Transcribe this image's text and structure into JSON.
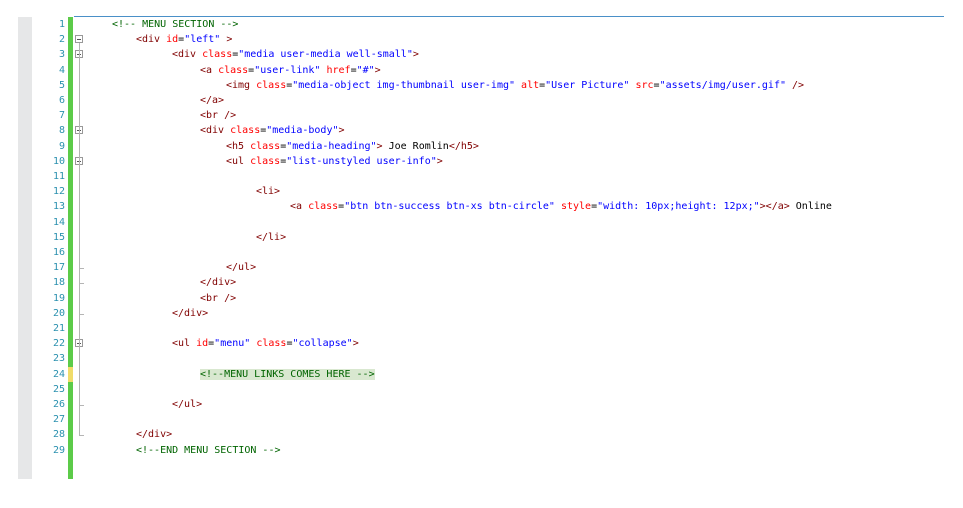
{
  "editor": {
    "line_numbers": [
      "1",
      "2",
      "3",
      "4",
      "5",
      "6",
      "7",
      "8",
      "9",
      "10",
      "11",
      "12",
      "13",
      "14",
      "15",
      "16",
      "17",
      "18",
      "19",
      "20",
      "21",
      "22",
      "23",
      "24",
      "25",
      "26",
      "27",
      "28",
      "29"
    ],
    "highlighted_line": 24,
    "colors": {
      "tag": "#800000",
      "attribute": "#ff0000",
      "value": "#0000ff",
      "comment": "#006400",
      "line_number": "#2b91af",
      "change_bar": "#5ccb49",
      "change_bar_modified": "#f0dc6a",
      "comment_highlight": "#d9e8d0"
    },
    "lines": [
      {
        "indent": 1,
        "tokens": [
          {
            "t": "comment",
            "v": "<!-- MENU SECTION -->"
          }
        ]
      },
      {
        "indent": 2,
        "tokens": [
          {
            "t": "tag",
            "v": "<div "
          },
          {
            "t": "attr",
            "v": "id"
          },
          {
            "t": "text",
            "v": "="
          },
          {
            "t": "val",
            "v": "\"left\""
          },
          {
            "t": "tag",
            "v": " >"
          }
        ]
      },
      {
        "indent": 3,
        "tokens": [
          {
            "t": "tag",
            "v": "<div "
          },
          {
            "t": "attr",
            "v": "class"
          },
          {
            "t": "text",
            "v": "="
          },
          {
            "t": "val",
            "v": "\"media user-media well-small\""
          },
          {
            "t": "tag",
            "v": ">"
          }
        ]
      },
      {
        "indent": 4,
        "tokens": [
          {
            "t": "tag",
            "v": "<a "
          },
          {
            "t": "attr",
            "v": "class"
          },
          {
            "t": "text",
            "v": "="
          },
          {
            "t": "val",
            "v": "\"user-link\""
          },
          {
            "t": "text",
            "v": " "
          },
          {
            "t": "attr",
            "v": "href"
          },
          {
            "t": "text",
            "v": "="
          },
          {
            "t": "val",
            "v": "\"#\""
          },
          {
            "t": "tag",
            "v": ">"
          }
        ]
      },
      {
        "indent": 5,
        "tokens": [
          {
            "t": "tag",
            "v": "<img "
          },
          {
            "t": "attr",
            "v": "class"
          },
          {
            "t": "text",
            "v": "="
          },
          {
            "t": "val",
            "v": "\"media-object img-thumbnail user-img\""
          },
          {
            "t": "text",
            "v": " "
          },
          {
            "t": "attr",
            "v": "alt"
          },
          {
            "t": "text",
            "v": "="
          },
          {
            "t": "val",
            "v": "\"User Picture\""
          },
          {
            "t": "text",
            "v": " "
          },
          {
            "t": "attr",
            "v": "src"
          },
          {
            "t": "text",
            "v": "="
          },
          {
            "t": "val",
            "v": "\"assets/img/user.gif\""
          },
          {
            "t": "tag",
            "v": " />"
          }
        ]
      },
      {
        "indent": 4,
        "tokens": [
          {
            "t": "tag",
            "v": "</a>"
          }
        ]
      },
      {
        "indent": 4,
        "tokens": [
          {
            "t": "tag",
            "v": "<br />"
          }
        ]
      },
      {
        "indent": 4,
        "tokens": [
          {
            "t": "tag",
            "v": "<div "
          },
          {
            "t": "attr",
            "v": "class"
          },
          {
            "t": "text",
            "v": "="
          },
          {
            "t": "val",
            "v": "\"media-body\""
          },
          {
            "t": "tag",
            "v": ">"
          }
        ]
      },
      {
        "indent": 5,
        "tokens": [
          {
            "t": "tag",
            "v": "<h5 "
          },
          {
            "t": "attr",
            "v": "class"
          },
          {
            "t": "text",
            "v": "="
          },
          {
            "t": "val",
            "v": "\"media-heading\""
          },
          {
            "t": "tag",
            "v": ">"
          },
          {
            "t": "text",
            "v": " Joe Romlin"
          },
          {
            "t": "tag",
            "v": "</h5>"
          }
        ]
      },
      {
        "indent": 5,
        "tokens": [
          {
            "t": "tag",
            "v": "<ul "
          },
          {
            "t": "attr",
            "v": "class"
          },
          {
            "t": "text",
            "v": "="
          },
          {
            "t": "val",
            "v": "\"list-unstyled user-info\""
          },
          {
            "t": "tag",
            "v": ">"
          }
        ]
      },
      {
        "indent": 0,
        "tokens": []
      },
      {
        "indent": 6,
        "tokens": [
          {
            "t": "tag",
            "v": "<li>"
          }
        ]
      },
      {
        "indent": 7,
        "tokens": [
          {
            "t": "tag",
            "v": "<a "
          },
          {
            "t": "attr",
            "v": "class"
          },
          {
            "t": "text",
            "v": "="
          },
          {
            "t": "val",
            "v": "\"btn btn-success btn-xs btn-circle\""
          },
          {
            "t": "text",
            "v": " "
          },
          {
            "t": "attr",
            "v": "style"
          },
          {
            "t": "text",
            "v": "="
          },
          {
            "t": "val",
            "v": "\"width: 10px;height: 12px;\""
          },
          {
            "t": "tag",
            "v": "></a>"
          },
          {
            "t": "text",
            "v": " Online"
          }
        ]
      },
      {
        "indent": 0,
        "tokens": []
      },
      {
        "indent": 6,
        "tokens": [
          {
            "t": "tag",
            "v": "</li>"
          }
        ]
      },
      {
        "indent": 0,
        "tokens": []
      },
      {
        "indent": 5,
        "tokens": [
          {
            "t": "tag",
            "v": "</ul>"
          }
        ]
      },
      {
        "indent": 4,
        "tokens": [
          {
            "t": "tag",
            "v": "</div>"
          }
        ]
      },
      {
        "indent": 4,
        "tokens": [
          {
            "t": "tag",
            "v": "<br />"
          }
        ]
      },
      {
        "indent": 3,
        "tokens": [
          {
            "t": "tag",
            "v": "</div>"
          }
        ]
      },
      {
        "indent": 0,
        "tokens": []
      },
      {
        "indent": 3,
        "tokens": [
          {
            "t": "tag",
            "v": "<ul "
          },
          {
            "t": "attr",
            "v": "id"
          },
          {
            "t": "text",
            "v": "="
          },
          {
            "t": "val",
            "v": "\"menu\""
          },
          {
            "t": "text",
            "v": " "
          },
          {
            "t": "attr",
            "v": "class"
          },
          {
            "t": "text",
            "v": "="
          },
          {
            "t": "val",
            "v": "\"collapse\""
          },
          {
            "t": "tag",
            "v": ">"
          }
        ]
      },
      {
        "indent": 0,
        "tokens": []
      },
      {
        "indent": 4,
        "tokens": [
          {
            "t": "comment-hl",
            "v": "<!--MENU LINKS COMES HERE -->"
          }
        ]
      },
      {
        "indent": 0,
        "tokens": []
      },
      {
        "indent": 3,
        "tokens": [
          {
            "t": "tag",
            "v": "</ul>"
          }
        ]
      },
      {
        "indent": 0,
        "tokens": []
      },
      {
        "indent": 2,
        "tokens": [
          {
            "t": "tag",
            "v": "</div>"
          }
        ]
      },
      {
        "indent": 2,
        "tokens": [
          {
            "t": "comment",
            "v": "<!--END MENU SECTION -->"
          }
        ]
      }
    ]
  }
}
